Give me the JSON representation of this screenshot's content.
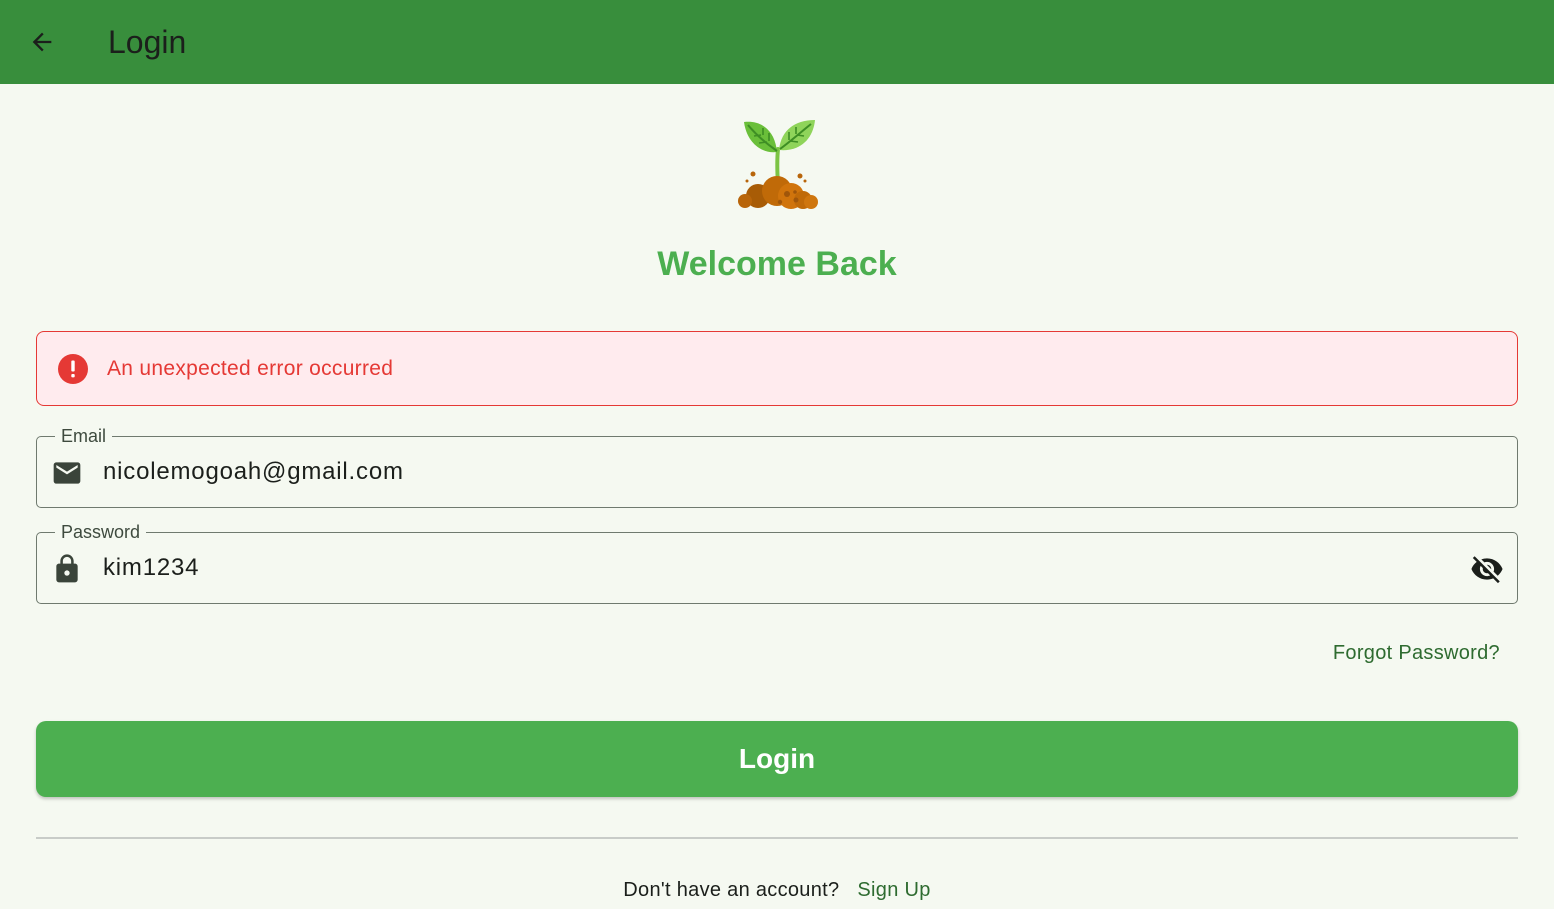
{
  "appbar": {
    "title": "Login",
    "back_icon": "arrow-back-icon",
    "background": "#388e3c"
  },
  "logo": {
    "icon": "sprout-icon"
  },
  "welcome": {
    "title": "Welcome Back",
    "color": "#4caf50"
  },
  "error": {
    "icon": "error-circle-icon",
    "message": "An unexpected error occurred",
    "color": "#e53935",
    "background": "#ffebee"
  },
  "email": {
    "label": "Email",
    "value": "nicolemogoah@gmail.com",
    "icon": "mail-icon"
  },
  "password": {
    "label": "Password",
    "value": "kim1234",
    "icon": "lock-icon",
    "toggle_icon": "visibility-off-icon"
  },
  "forgot": {
    "label": "Forgot Password?"
  },
  "login_button": {
    "label": "Login",
    "color": "#4caf50"
  },
  "signup": {
    "question": "Don't have an account?",
    "link": "Sign Up"
  }
}
